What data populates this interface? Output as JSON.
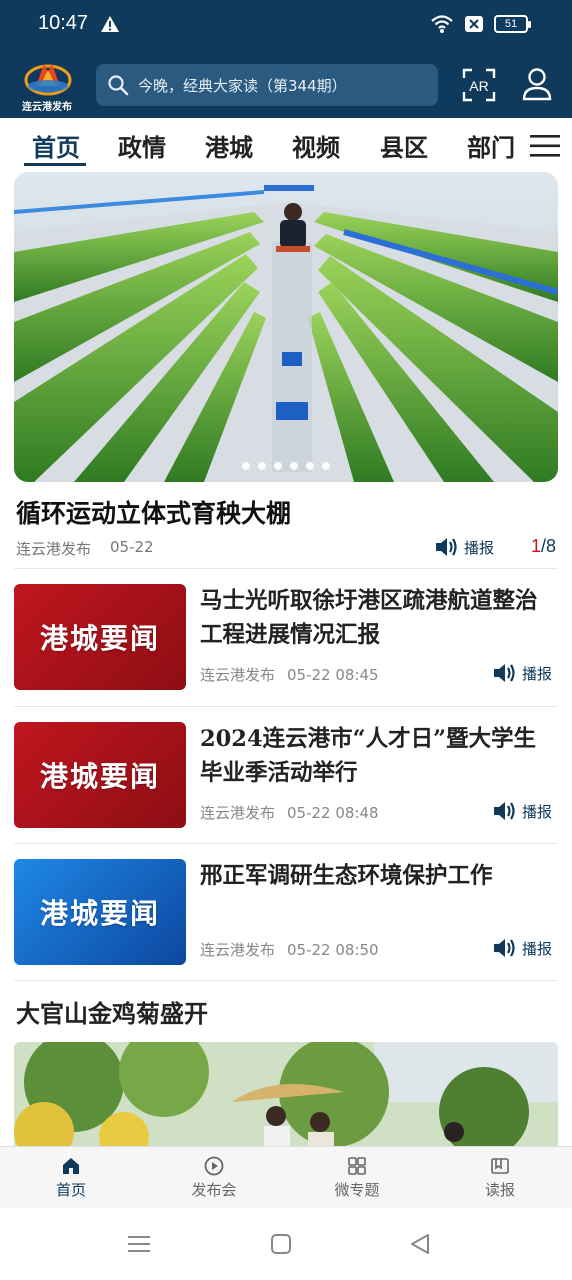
{
  "status_bar": {
    "time": "10:47",
    "battery": "51"
  },
  "header": {
    "logo_text": "连云港发布",
    "search_placeholder": "今晚，经典大家读（第344期）",
    "ar_label": "AR"
  },
  "tabs": [
    {
      "label": "首页",
      "active": true
    },
    {
      "label": "政情"
    },
    {
      "label": "港城"
    },
    {
      "label": "视频"
    },
    {
      "label": "县区"
    },
    {
      "label": "部门"
    }
  ],
  "hero": {
    "title": "循环运动立体式育秧大棚",
    "source": "连云港发布",
    "date": "05-22",
    "play_label": "播报",
    "page_current": "1",
    "page_total": "/8"
  },
  "news": [
    {
      "thumb_text": "港城要闻",
      "title": "马士光听取徐圩港区疏港航道整治工程进展情况汇报",
      "source": "连云港发布",
      "date": "05-22 08:45",
      "play_label": "播报"
    },
    {
      "thumb_text": "港城要闻",
      "title": "2024连云港市“人才日”暨大学生毕业季活动举行",
      "source": "连云港发布",
      "date": "05-22 08:48",
      "play_label": "播报"
    },
    {
      "thumb_text": "港城要闻",
      "title": "邢正军调研生态环境保护工作",
      "source": "连云港发布",
      "date": "05-22 08:50",
      "play_label": "播报"
    }
  ],
  "section_title": "大官山金鸡菊盛开",
  "bottom_nav": [
    {
      "label": "首页",
      "icon": "home-icon",
      "active": true
    },
    {
      "label": "发布会",
      "icon": "play-circle-icon"
    },
    {
      "label": "微专题",
      "icon": "grid-icon"
    },
    {
      "label": "读报",
      "icon": "newspaper-icon"
    }
  ],
  "colors": {
    "brand": "#0f3a5c",
    "accent_red": "#c8141e",
    "thumb_red": "#b5121b",
    "thumb_blue": "#1565c0"
  }
}
